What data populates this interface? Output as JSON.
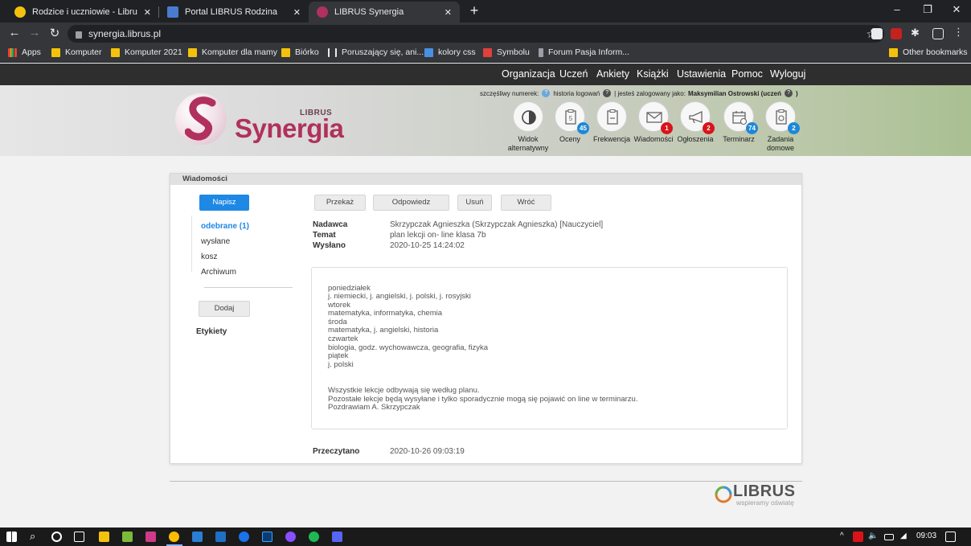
{
  "browser": {
    "tabs": [
      {
        "title": "Rodzice i uczniowie - Librus - sys",
        "color": "#f4c20d"
      },
      {
        "title": "Portal LIBRUS Rodzina",
        "color": "#4a7bd0"
      },
      {
        "title": "LIBRUS Synergia",
        "color": "#b0315d"
      }
    ],
    "url": "synergia.librus.pl",
    "bookmarks": [
      "Apps",
      "Komputer",
      "Komputer 2021",
      "Komputer dla mamy",
      "Biórko",
      "Poruszający się, ani...",
      "kolory css",
      "Symbolu",
      "Forum Pasja Inform...",
      "Other bookmarks"
    ]
  },
  "menu": [
    "Organizacja",
    "Uczeń",
    "Ankiety",
    "Książki",
    "Ustawienia",
    "Pomoc",
    "Wyloguj"
  ],
  "header": {
    "lucky_number_label": "szczęśliwy numerek:",
    "login_history_label": "historia logowań",
    "logged_as_label": "| jesteś zalogowany jako:",
    "user_name": "Maksymilian Ostrowski (uczeń",
    "user_close": ")",
    "logo_small": "LIBRUS",
    "logo_big": "Synergia"
  },
  "icons": [
    {
      "label": "Widok alternatywny",
      "icon": "contrast-icon"
    },
    {
      "label": "Oceny",
      "icon": "grades-icon",
      "badge": "45",
      "badge_color": "blue"
    },
    {
      "label": "Frekwencja",
      "icon": "attendance-icon"
    },
    {
      "label": "Wiadomości",
      "icon": "envelope-icon",
      "badge": "1",
      "badge_color": "red"
    },
    {
      "label": "Ogłoszenia",
      "icon": "megaphone-icon",
      "badge": "2",
      "badge_color": "red"
    },
    {
      "label": "Terminarz",
      "icon": "calendar-icon",
      "badge": "74",
      "badge_color": "blue"
    },
    {
      "label": "Zadania domowe",
      "icon": "homework-icon",
      "badge": "2",
      "badge_color": "blue"
    }
  ],
  "panel": {
    "title": "Wiadomości",
    "compose": "Napisz",
    "folders": [
      "odebrane (1)",
      "wysłane",
      "kosz",
      "Archiwum"
    ],
    "add": "Dodaj",
    "labels": "Etykiety",
    "actions": [
      "Przekaż",
      "Odpowiedz",
      "Usuń",
      "Wróć"
    ]
  },
  "message": {
    "sender_label": "Nadawca",
    "sender": "Skrzypczak Agnieszka (Skrzypczak Agnieszka) [Nauczyciel]",
    "subject_label": "Temat",
    "subject": "plan lekcji on- line klasa 7b",
    "sent_label": "Wysłano",
    "sent": "2020-10-25 14:24:02",
    "body": [
      "poniedziałek",
      "j. niemiecki, j. angielski, j. polski, j. rosyjski",
      "wtorek",
      "matematyka, informatyka, chemia",
      "środa",
      "matematyka, j. angielski, historia",
      "czwartek",
      "biologia, godz. wychowawcza, geografia, fizyka",
      "piątek",
      "j. polski",
      "",
      "",
      "Wszystkie lekcje odbywają się według planu.",
      "Pozostałe lekcje będą wysyłane i tylko sporadycznie mogą się pojawić on line w terminarzu.",
      "Pozdrawiam A. Skrzypczak"
    ],
    "read_label": "Przeczytano",
    "read": "2020-10-26 09:03:19"
  },
  "footer": {
    "brand": "LIBRUS",
    "tagline": "wspieramy oświatę"
  },
  "taskbar": {
    "time": "09:03"
  }
}
